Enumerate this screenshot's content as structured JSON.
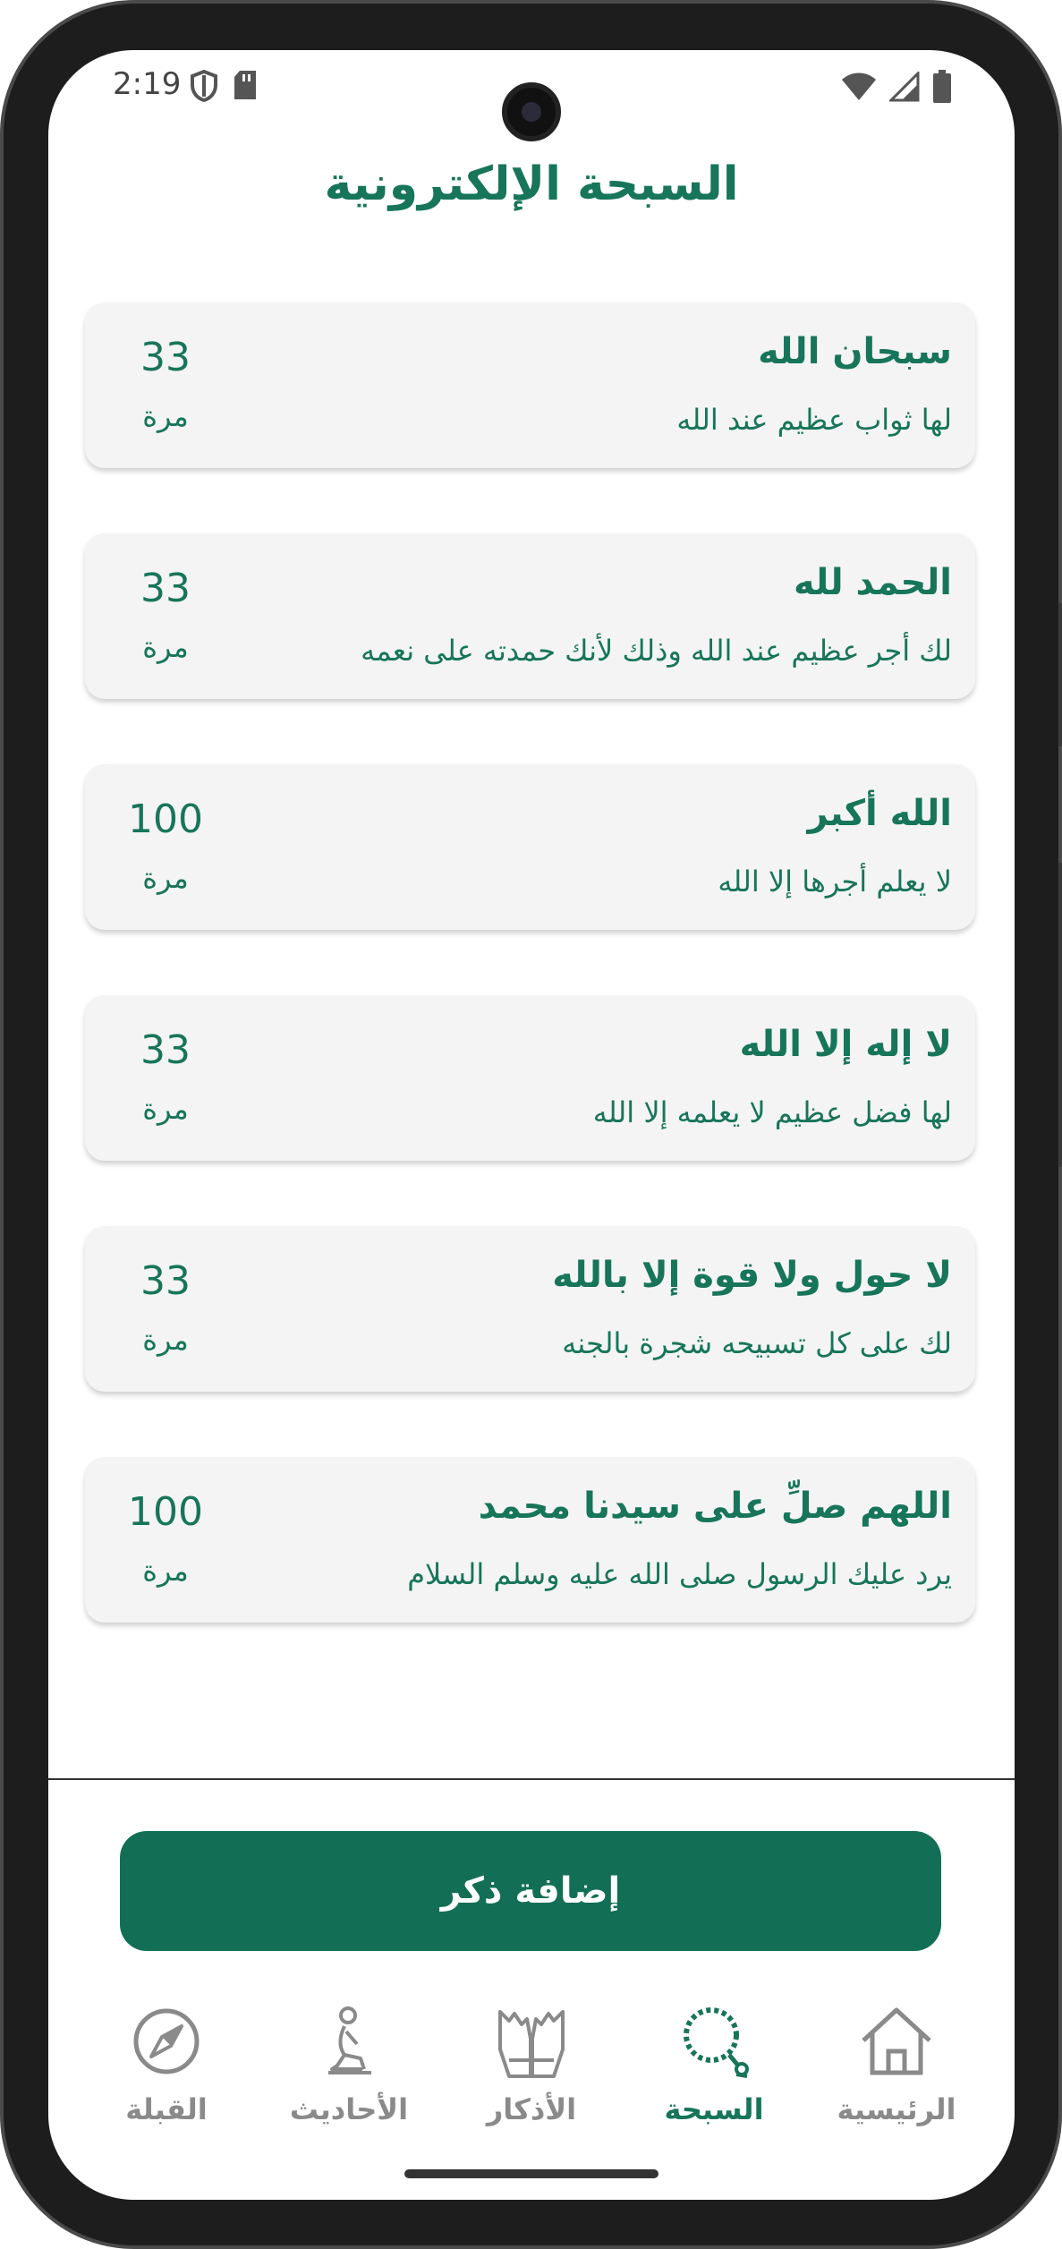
{
  "status": {
    "time": "2:19"
  },
  "title": "السبحة الإلكترونية",
  "items": [
    {
      "title": "سبحان الله",
      "desc": "لها ثواب عظيم عند الله",
      "count": "33",
      "unit": "مرة"
    },
    {
      "title": "الحمد لله",
      "desc": "لك أجر عظيم عند الله وذلك لأنك حمدته على نعمه",
      "count": "33",
      "unit": "مرة"
    },
    {
      "title": "الله أكبر",
      "desc": "لا يعلم أجرها إلا الله",
      "count": "100",
      "unit": "مرة"
    },
    {
      "title": "لا إله إلا الله",
      "desc": "لها فضل عظيم لا يعلمه إلا الله",
      "count": "33",
      "unit": "مرة"
    },
    {
      "title": "لا حول ولا قوة إلا بالله",
      "desc": "لك على كل تسبيحه شجرة بالجنه",
      "count": "33",
      "unit": "مرة"
    },
    {
      "title": "اللهم صلِّ على سيدنا محمد",
      "desc": "يرد عليك الرسول صلى الله عليه وسلم السلام",
      "count": "100",
      "unit": "مرة"
    }
  ],
  "add_button": "إضافة ذكر",
  "nav": [
    {
      "label": "الرئيسية",
      "icon": "home-icon",
      "active": false
    },
    {
      "label": "السبحة",
      "icon": "prayer-beads-icon",
      "active": true
    },
    {
      "label": "الأذكار",
      "icon": "praying-hands-icon",
      "active": false
    },
    {
      "label": "الأحاديث",
      "icon": "praying-person-icon",
      "active": false
    },
    {
      "label": "القبلة",
      "icon": "compass-icon",
      "active": false
    }
  ],
  "colors": {
    "primary": "#17755a",
    "button": "#126f55",
    "card_bg": "#f4f4f4",
    "inactive": "#8a8a8a"
  }
}
